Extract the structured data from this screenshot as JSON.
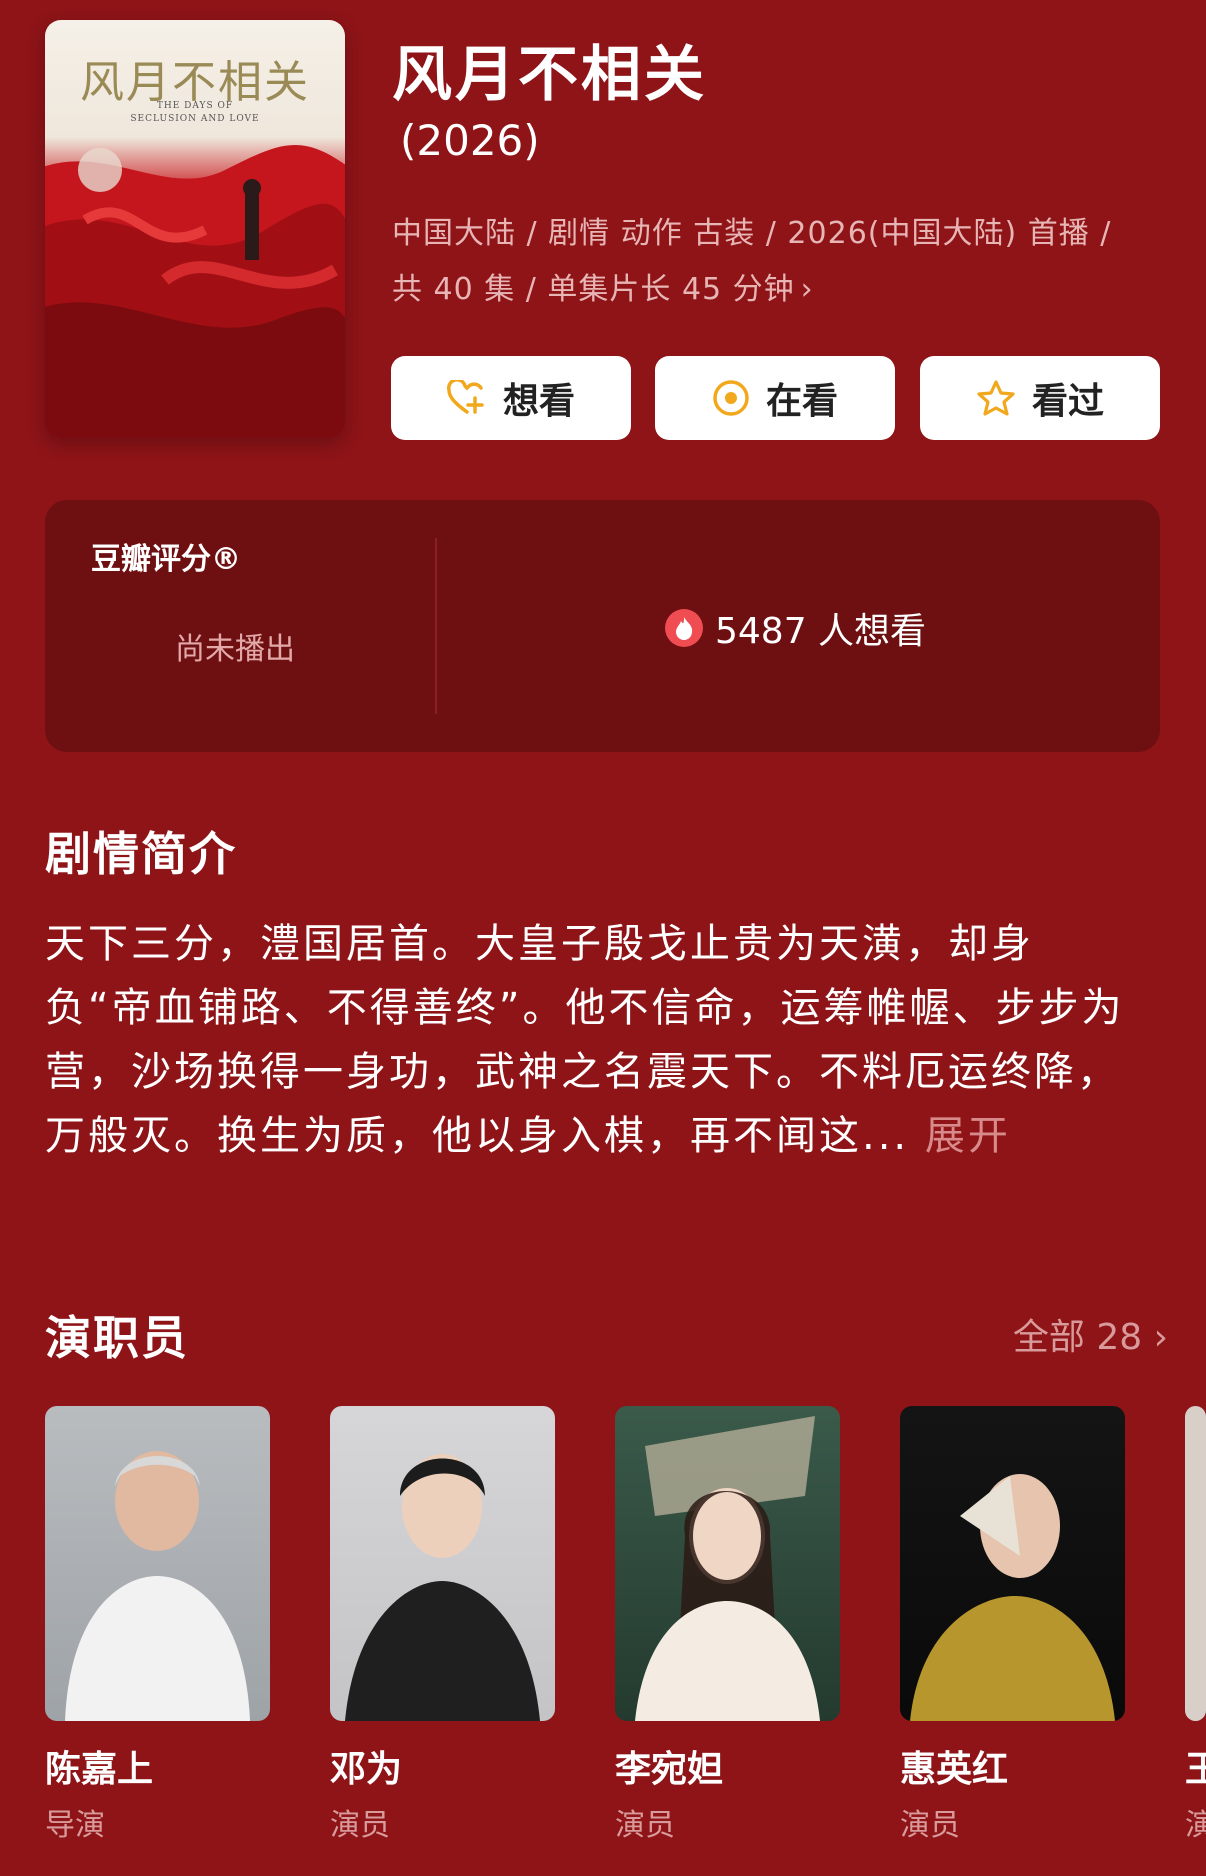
{
  "poster": {
    "title": "风月不相关",
    "subtitle": "THE DAYS OF\nSECLUSION AND LOVE"
  },
  "header": {
    "title": "风月不相关",
    "year": "(2026)",
    "meta_line1": "中国大陆 / 剧情 动作 古装 / 2026(中国大陆) 首播 /",
    "meta_line2": "共 40 集 / 单集片长 45 分钟"
  },
  "actions": [
    {
      "label": "想看",
      "icon": "heart-plus-icon"
    },
    {
      "label": "在看",
      "icon": "target-circle-icon"
    },
    {
      "label": "看过",
      "icon": "star-icon"
    }
  ],
  "rating": {
    "label": "豆瓣评分®",
    "status": "尚未播出",
    "want_count": "5487 人想看"
  },
  "synopsis": {
    "heading": "剧情简介",
    "text": "天下三分，澧国居首。大皇子殷戈止贵为天潢，却身负“帝血铺路、不得善终”。他不信命，运筹帷幄、步步为营，沙场换得一身功，武神之名震天下。不料厄运终降，万般灭。换生为质，他以身入棋，再不闻这...",
    "expand": "展开"
  },
  "cast": {
    "heading": "演职员",
    "all_label": "全部 28",
    "members": [
      {
        "name": "陈嘉上",
        "role": "导演"
      },
      {
        "name": "邓为",
        "role": "演员"
      },
      {
        "name": "李宛妲",
        "role": "演员"
      },
      {
        "name": "惠英红",
        "role": "演员"
      },
      {
        "name": "王",
        "role": "演"
      }
    ]
  },
  "colors": {
    "background": "#8e1418",
    "card": "#6e0f12",
    "button_icon": "#f2a81d",
    "fire": "#ef4d52"
  }
}
